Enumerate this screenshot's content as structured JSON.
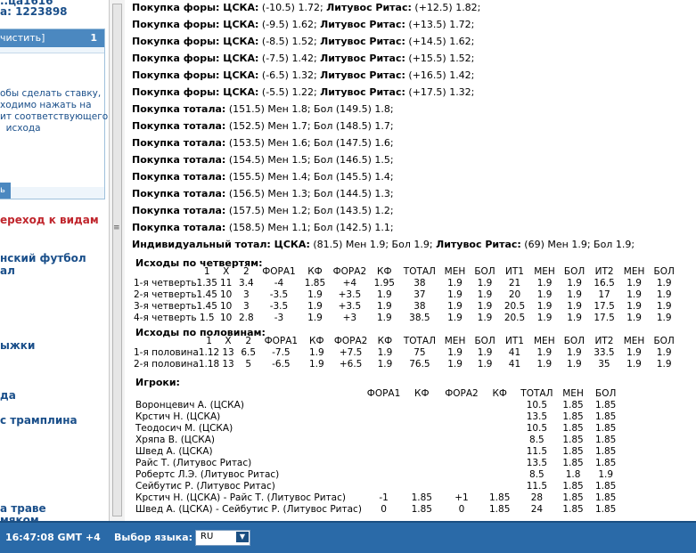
{
  "account": {
    "line1": "..ца1616",
    "line2": "а: 1223898"
  },
  "coupon": {
    "clear": "чистить]",
    "count": "1",
    "hint": "обы сделать ставку,\nходимо нажать на\nит соответствующего\n  исхода",
    "button": "ь"
  },
  "nav": {
    "transition": "ереход к видам",
    "sports": [
      "нский футбол",
      "ал",
      "",
      "",
      "ыжки",
      "",
      "да",
      "с трамплина",
      "",
      "",
      "а траве",
      "мяком"
    ]
  },
  "main": {
    "lines": [
      [
        "Покупка форы: ЦСКА:",
        " (-10.5) 1.72; ",
        "Литувос Ритас:",
        " (+12.5) 1.82;"
      ],
      [
        "Покупка форы: ЦСКА:",
        " (-9.5) 1.62; ",
        "Литувос Ритас:",
        " (+13.5) 1.72;"
      ],
      [
        "Покупка форы: ЦСКА:",
        " (-8.5) 1.52; ",
        "Литувос Ритас:",
        " (+14.5) 1.62;"
      ],
      [
        "Покупка форы: ЦСКА:",
        " (-7.5) 1.42; ",
        "Литувос Ритас:",
        " (+15.5) 1.52;"
      ],
      [
        "Покупка форы: ЦСКА:",
        " (-6.5) 1.32; ",
        "Литувос Ритас:",
        " (+16.5) 1.42;"
      ],
      [
        "Покупка форы: ЦСКА:",
        " (-5.5) 1.22; ",
        "Литувос Ритас:",
        " (+17.5) 1.32;"
      ],
      [
        "Покупка тотала:",
        " (151.5) Мен 1.8; Бол (149.5) 1.8;",
        "",
        ""
      ],
      [
        "Покупка тотала:",
        " (152.5) Мен 1.7; Бол (148.5) 1.7;",
        "",
        ""
      ],
      [
        "Покупка тотала:",
        " (153.5) Мен 1.6; Бол (147.5) 1.6;",
        "",
        ""
      ],
      [
        "Покупка тотала:",
        " (154.5) Мен 1.5; Бол (146.5) 1.5;",
        "",
        ""
      ],
      [
        "Покупка тотала:",
        " (155.5) Мен 1.4; Бол (145.5) 1.4;",
        "",
        ""
      ],
      [
        "Покупка тотала:",
        " (156.5) Мен 1.3; Бол (144.5) 1.3;",
        "",
        ""
      ],
      [
        "Покупка тотала:",
        " (157.5) Мен 1.2; Бол (143.5) 1.2;",
        "",
        ""
      ],
      [
        "Покупка тотала:",
        " (158.5) Мен 1.1; Бол (142.5) 1.1;",
        "",
        ""
      ],
      [
        "Индивидуальный тотал: ЦСКА:",
        " (81.5) Мен 1.9; Бол 1.9; ",
        "Литувос Ритас:",
        " (69) Мен 1.9; Бол 1.9;"
      ]
    ],
    "quarters": {
      "title": "Исходы по четвертям:",
      "headers": [
        "",
        "1",
        "X",
        "2",
        "ФОРА1",
        "КФ",
        "ФОРА2",
        "КФ",
        "ТОТАЛ",
        "МЕН",
        "БОЛ",
        "ИТ1",
        "МЕН",
        "БОЛ",
        "ИТ2",
        "МЕН",
        "БОЛ"
      ],
      "rows": [
        [
          "1-я четверть",
          "1.35",
          "11",
          "3.4",
          "-4",
          "1.85",
          "+4",
          "1.95",
          "38",
          "1.9",
          "1.9",
          "21",
          "1.9",
          "1.9",
          "16.5",
          "1.9",
          "1.9"
        ],
        [
          "2-я четверть",
          "1.45",
          "10",
          "3",
          "-3.5",
          "1.9",
          "+3.5",
          "1.9",
          "37",
          "1.9",
          "1.9",
          "20",
          "1.9",
          "1.9",
          "17",
          "1.9",
          "1.9"
        ],
        [
          "3-я четверть",
          "1.45",
          "10",
          "3",
          "-3.5",
          "1.9",
          "+3.5",
          "1.9",
          "38",
          "1.9",
          "1.9",
          "20.5",
          "1.9",
          "1.9",
          "17.5",
          "1.9",
          "1.9"
        ],
        [
          "4-я четверть",
          "1.5",
          "10",
          "2.8",
          "-3",
          "1.9",
          "+3",
          "1.9",
          "38.5",
          "1.9",
          "1.9",
          "20.5",
          "1.9",
          "1.9",
          "17.5",
          "1.9",
          "1.9"
        ]
      ]
    },
    "halves": {
      "title": "Исходы по половинам:",
      "headers": [
        "",
        "1",
        "X",
        "2",
        "ФОРА1",
        "КФ",
        "ФОРА2",
        "КФ",
        "ТОТАЛ",
        "МЕН",
        "БОЛ",
        "ИТ1",
        "МЕН",
        "БОЛ",
        "ИТ2",
        "МЕН",
        "БОЛ"
      ],
      "rows": [
        [
          "1-я половина",
          "1.12",
          "13",
          "6.5",
          "-7.5",
          "1.9",
          "+7.5",
          "1.9",
          "75",
          "1.9",
          "1.9",
          "41",
          "1.9",
          "1.9",
          "33.5",
          "1.9",
          "1.9"
        ],
        [
          "2-я половина",
          "1.18",
          "13",
          "5",
          "-6.5",
          "1.9",
          "+6.5",
          "1.9",
          "76.5",
          "1.9",
          "1.9",
          "41",
          "1.9",
          "1.9",
          "35",
          "1.9",
          "1.9"
        ]
      ]
    },
    "players": {
      "title": "Игроки:",
      "headers": [
        "",
        "ФОРА1",
        "КФ",
        "ФОРА2",
        "КФ",
        "ТОТАЛ",
        "МЕН",
        "БОЛ"
      ],
      "rows": [
        [
          "Воронцевич А. (ЦСКА)",
          "",
          "",
          "",
          "",
          "10.5",
          "1.85",
          "1.85"
        ],
        [
          "Крстич Н. (ЦСКА)",
          "",
          "",
          "",
          "",
          "13.5",
          "1.85",
          "1.85"
        ],
        [
          "Теодосич М. (ЦСКА)",
          "",
          "",
          "",
          "",
          "10.5",
          "1.85",
          "1.85"
        ],
        [
          "Хряпа В. (ЦСКА)",
          "",
          "",
          "",
          "",
          "8.5",
          "1.85",
          "1.85"
        ],
        [
          "Швед А. (ЦСКА)",
          "",
          "",
          "",
          "",
          "11.5",
          "1.85",
          "1.85"
        ],
        [
          "Райс Т. (Литувос Ритас)",
          "",
          "",
          "",
          "",
          "13.5",
          "1.85",
          "1.85"
        ],
        [
          "Робертс Л.Э. (Литувос Ритас)",
          "",
          "",
          "",
          "",
          "8.5",
          "1.8",
          "1.9"
        ],
        [
          "Сейбутис Р. (Литувос Ритас)",
          "",
          "",
          "",
          "",
          "11.5",
          "1.85",
          "1.85"
        ],
        [
          "Крстич Н. (ЦСКА) - Райс Т. (Литувос Ритас)",
          "-1",
          "1.85",
          "+1",
          "1.85",
          "28",
          "1.85",
          "1.85"
        ],
        [
          "Швед А. (ЦСКА) - Сейбутис Р. (Литувос Ритас)",
          "0",
          "1.85",
          "0",
          "1.85",
          "24",
          "1.85",
          "1.85"
        ]
      ]
    }
  },
  "footer": {
    "time": "16:47:08  GMT +4",
    "lang_label": "Выбор языка:",
    "lang_value": "RU"
  },
  "colors": {
    "header_blue": "#2a6aa8",
    "link_blue": "#1a4f8a",
    "accent_red": "#c0262d"
  }
}
